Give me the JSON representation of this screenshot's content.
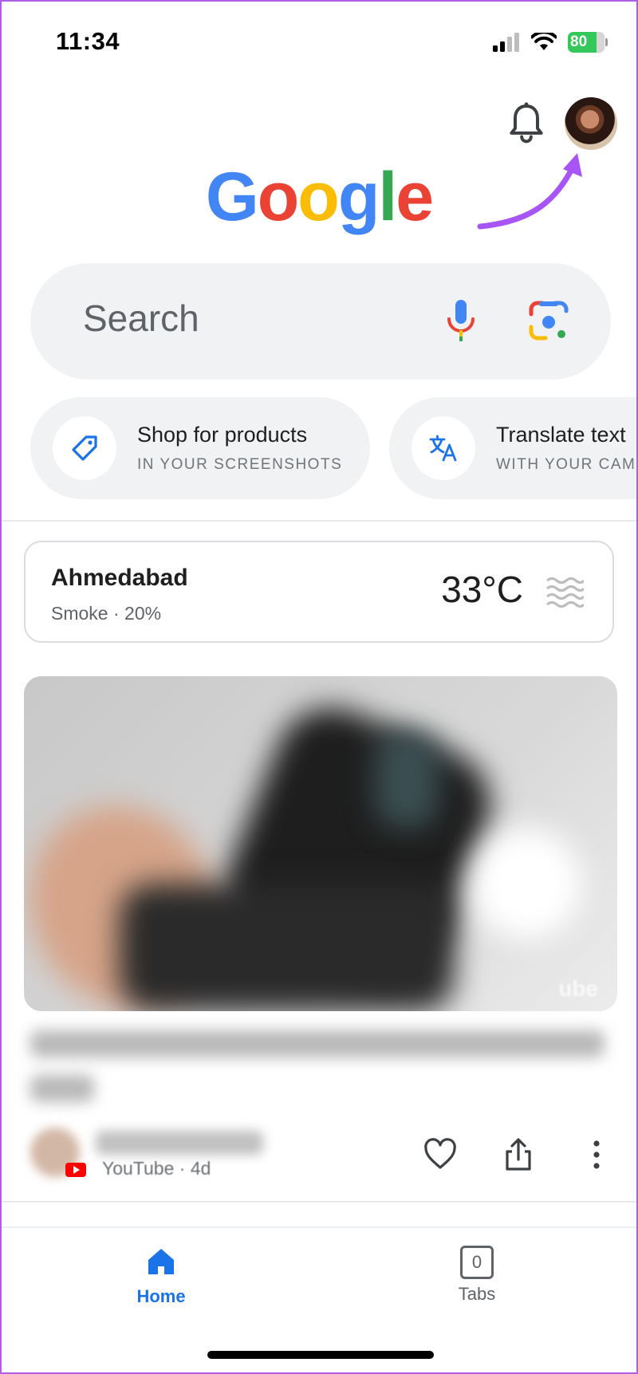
{
  "status": {
    "time": "11:34",
    "battery": "80"
  },
  "logo": {
    "letters": [
      "G",
      "o",
      "o",
      "g",
      "l",
      "e"
    ],
    "colors": [
      "#4285F4",
      "#EA4335",
      "#FBBC05",
      "#4285F4",
      "#34A853",
      "#EA4335"
    ]
  },
  "search": {
    "placeholder": "Search"
  },
  "chips": [
    {
      "title": "Shop for products",
      "subtitle": "IN YOUR SCREENSHOTS",
      "icon": "tag-icon"
    },
    {
      "title": "Translate text",
      "subtitle": "WITH YOUR CAMERA",
      "icon": "translate-icon"
    }
  ],
  "weather": {
    "city": "Ahmedabad",
    "condition": "Smoke · 20%",
    "temperature": "33°C",
    "icon": "haze-icon"
  },
  "feed": {
    "source_meta": "YouTube · 4d",
    "watermark": "ube"
  },
  "nav": {
    "home": "Home",
    "tabs": "Tabs",
    "tab_count": "0"
  },
  "colors": {
    "accent": "#1a73e8",
    "annotation": "#a855f7"
  }
}
